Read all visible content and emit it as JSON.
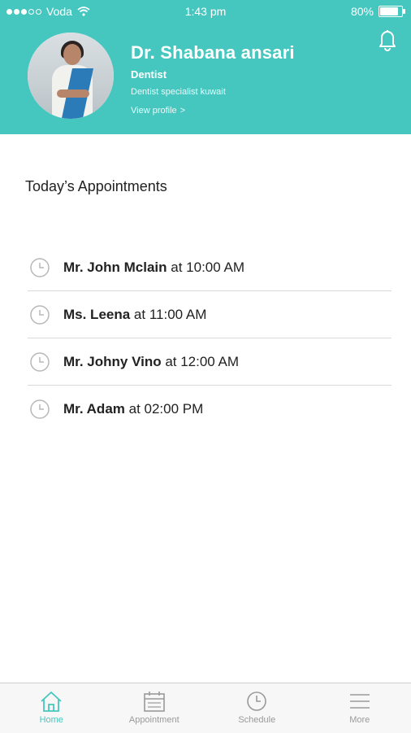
{
  "status_bar": {
    "carrier": "Voda",
    "time": "1:43 pm",
    "battery": "80%"
  },
  "profile": {
    "name": "Dr. Shabana ansari",
    "title": "Dentist",
    "subtitle": "Dentist specialist kuwait",
    "view_profile": "View profile",
    "view_profile_chevron": ">"
  },
  "appointments": {
    "heading": "Today’s Appointments",
    "items": [
      {
        "name": "Mr. John Mclain",
        "time": " at 10:00 AM"
      },
      {
        "name": "Ms. Leena",
        "time": " at 11:00 AM"
      },
      {
        "name": "Mr. Johny Vino",
        "time": " at 12:00 AM"
      },
      {
        "name": "Mr. Adam",
        "time": " at 02:00 PM"
      }
    ]
  },
  "tabbar": {
    "tabs": [
      {
        "label": "Home",
        "icon": "home-icon",
        "active": true
      },
      {
        "label": "Appointment",
        "icon": "calendar-icon",
        "active": false
      },
      {
        "label": "Schedule",
        "icon": "clock-icon",
        "active": false
      },
      {
        "label": "More",
        "icon": "menu-icon",
        "active": false
      }
    ]
  },
  "colors": {
    "accent": "#45c7c0",
    "text": "#222222",
    "muted": "#9a9a9a",
    "divider": "#d9d9d9"
  }
}
